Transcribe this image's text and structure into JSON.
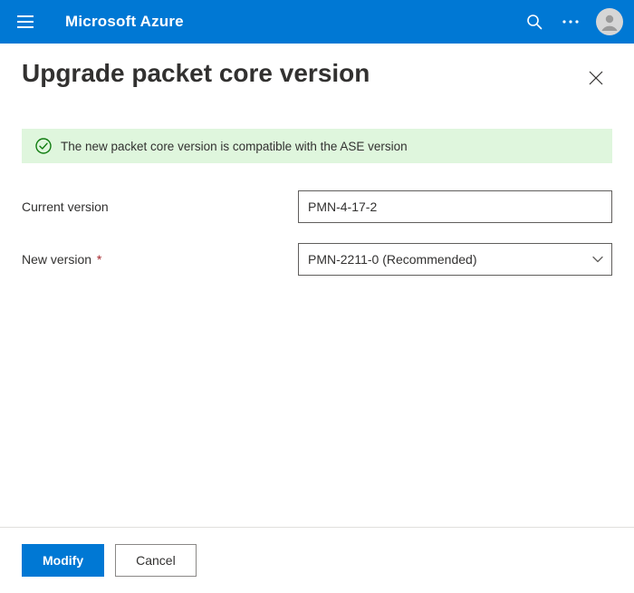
{
  "header": {
    "brand": "Microsoft Azure"
  },
  "blade": {
    "title": "Upgrade packet core version"
  },
  "status": {
    "message": "The new packet core version is compatible with the ASE version",
    "color": "#107c10",
    "background": "#dff6dd"
  },
  "form": {
    "current_version_label": "Current version",
    "current_version_value": "PMN-4-17-2",
    "new_version_label": "New version",
    "new_version_required": "*",
    "new_version_value": "PMN-2211-0 (Recommended)"
  },
  "footer": {
    "modify_label": "Modify",
    "cancel_label": "Cancel"
  }
}
